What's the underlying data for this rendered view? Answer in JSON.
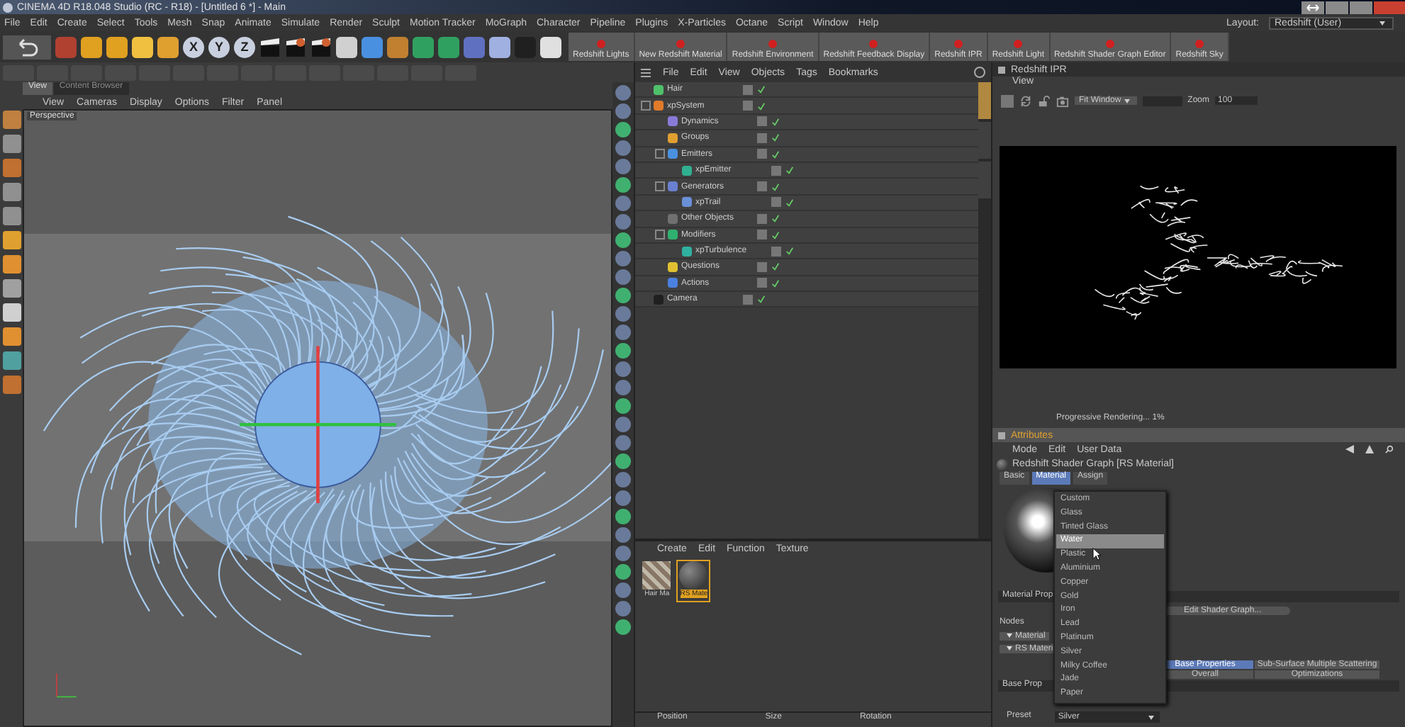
{
  "window": {
    "title": "CINEMA 4D R18.048 Studio (RC - R18) - [Untitled 6 *] - Main"
  },
  "menu_bar": [
    "File",
    "Edit",
    "Create",
    "Select",
    "Tools",
    "Mesh",
    "Snap",
    "Animate",
    "Simulate",
    "Render",
    "Sculpt",
    "Motion Tracker",
    "MoGraph",
    "Character",
    "Pipeline",
    "Plugins",
    "X-Particles",
    "Octane",
    "Script",
    "Window",
    "Help"
  ],
  "layout": {
    "label": "Layout:",
    "value": "Redshift (User)"
  },
  "axis_buttons": [
    "X",
    "Y",
    "Z"
  ],
  "redshift_buttons": [
    "Redshift Lights",
    "New Redshift Material",
    "Redshift Environment",
    "Redshift Feedback Display",
    "Redshift IPR",
    "Redshift Light",
    "Redshift Shader Graph Editor",
    "Redshift Sky"
  ],
  "viewport": {
    "tabs": [
      {
        "label": "View",
        "selected": true
      },
      {
        "label": "Content Browser",
        "selected": false
      }
    ],
    "menu": [
      "View",
      "Cameras",
      "Display",
      "Options",
      "Filter",
      "Panel"
    ],
    "camera": "Perspective"
  },
  "object_manager": {
    "menu": [
      "File",
      "Edit",
      "View",
      "Objects",
      "Tags",
      "Bookmarks"
    ],
    "objects": [
      {
        "name": "Hair",
        "color": "#4fc06a"
      },
      {
        "name": "xpSystem",
        "color": "#e07a2a",
        "children": [
          {
            "name": "Dynamics",
            "color": "#8a7ad8"
          },
          {
            "name": "Groups",
            "color": "#e0a030"
          },
          {
            "name": "Emitters",
            "color": "#4a90e0",
            "children": [
              {
                "name": "xpEmitter",
                "color": "#30b090"
              }
            ]
          },
          {
            "name": "Generators",
            "color": "#6a80d0",
            "children": [
              {
                "name": "xpTrail",
                "color": "#6a90d8"
              }
            ]
          },
          {
            "name": "Other Objects",
            "color": "#707070"
          },
          {
            "name": "Modifiers",
            "color": "#30b070",
            "children": [
              {
                "name": "xpTurbulence",
                "color": "#30b0a0"
              }
            ]
          },
          {
            "name": "Questions",
            "color": "#e0c030"
          },
          {
            "name": "Actions",
            "color": "#4a80e0"
          }
        ]
      },
      {
        "name": "Camera",
        "color": "#202020"
      }
    ]
  },
  "side_tabs": [
    {
      "selected": true
    },
    {
      "selected": false
    },
    {
      "selected": false
    }
  ],
  "material_manager": {
    "menu": [
      "Create",
      "Edit",
      "Function",
      "Texture"
    ],
    "materials": [
      {
        "name": "Hair Ma",
        "selected": false
      },
      {
        "name": "RS Mate",
        "selected": true
      }
    ]
  },
  "coordinates": {
    "headers": [
      "Position",
      "Size",
      "Rotation"
    ]
  },
  "ipr": {
    "title": "Redshift IPR",
    "menu": [
      "View"
    ],
    "fit": "Fit Window",
    "zoom_label": "Zoom",
    "zoom_value": "100",
    "status": "Progressive Rendering... 1%"
  },
  "attributes": {
    "title": "Attributes",
    "menu": [
      "Mode",
      "Edit",
      "User Data"
    ],
    "object": "Redshift Shader Graph [RS Material]",
    "tabs": [
      {
        "label": "Basic",
        "selected": false
      },
      {
        "label": "Material",
        "selected": true
      },
      {
        "label": "Assign",
        "selected": false
      }
    ],
    "section_label": "Material Prop",
    "edit_button": "Edit Shader Graph...",
    "nodes_label": "Nodes",
    "groups": [
      "Material",
      "RS Materi"
    ],
    "prop_tabs": [
      {
        "label": "Base Properties",
        "selected": true
      },
      {
        "label": "Sub-Surface Multiple Scattering",
        "selected": false
      },
      {
        "label": "Overall",
        "selected": false
      },
      {
        "label": "Optimizations",
        "selected": false
      }
    ],
    "base_prop": "Base Prop",
    "preset_label": "Preset",
    "preset_value": "Silver",
    "dropdown": [
      {
        "label": "Custom",
        "selected": false
      },
      {
        "label": "Glass",
        "selected": false
      },
      {
        "label": "Tinted Glass",
        "selected": false
      },
      {
        "label": "Water",
        "selected": true
      },
      {
        "label": "Plastic",
        "selected": false
      },
      {
        "label": "Aluminium",
        "selected": false
      },
      {
        "label": "Copper",
        "selected": false
      },
      {
        "label": "Gold",
        "selected": false
      },
      {
        "label": "Iron",
        "selected": false
      },
      {
        "label": "Lead",
        "selected": false
      },
      {
        "label": "Platinum",
        "selected": false
      },
      {
        "label": "Silver",
        "selected": false
      },
      {
        "label": "Milky Coffee",
        "selected": false
      },
      {
        "label": "Jade",
        "selected": false
      },
      {
        "label": "Paper",
        "selected": false
      }
    ]
  }
}
